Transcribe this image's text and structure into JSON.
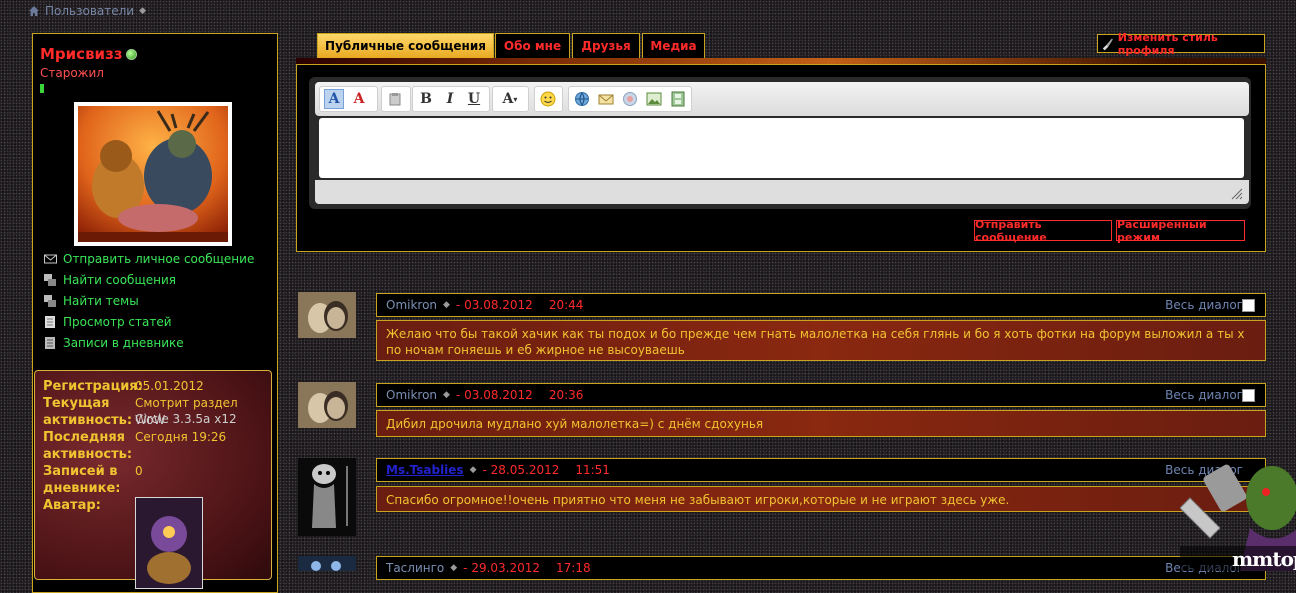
{
  "breadcrumb": {
    "item": "Пользователи"
  },
  "profile": {
    "username": "Мрисвизз",
    "title": "Старожил",
    "links": [
      {
        "label": "Отправить личное сообщение",
        "icon": "envelope-icon"
      },
      {
        "label": "Найти сообщения",
        "icon": "posts-icon"
      },
      {
        "label": "Найти темы",
        "icon": "threads-icon"
      },
      {
        "label": "Просмотр статей",
        "icon": "article-icon"
      },
      {
        "label": "Записи в дневнике",
        "icon": "diary-icon"
      }
    ],
    "info": {
      "reg_label": "Регистрация:",
      "reg_value": "05.01.2012",
      "act_label1": "Текущая",
      "act_label2": "активность:",
      "act_value": "Смотрит раздел",
      "act_link": "WoW",
      "act_value2": "Circle 3.3.5a x12",
      "last_label1": "Последняя",
      "last_label2": "активность:",
      "last_value": "Сегодня 19:26",
      "diary_label1": "Записей в",
      "diary_label2": "дневнике:",
      "diary_value": "0",
      "avatar_label": "Аватар:"
    }
  },
  "tabs": [
    {
      "label": "Публичные сообщения",
      "active": true
    },
    {
      "label": "Обо мне",
      "active": false
    },
    {
      "label": "Друзья",
      "active": false
    },
    {
      "label": "Медиа",
      "active": false
    }
  ],
  "style_button": "Изменить стиль профиля",
  "editor": {
    "send": "Отправить сообщение",
    "advanced": "Расширенный режим"
  },
  "messages": [
    {
      "author": "Omikron",
      "date": "- 03.08.2012",
      "time": "20:44",
      "dialog": "Весь диалог",
      "text": "Желаю что бы такой хачик как ты подох и бо прежде чем гнать малолетка на себя глянь и бо я хоть фотки на форум выложил а ты х по ночам гоняешь и еб жирное не высоуваешь"
    },
    {
      "author": "Omikron",
      "date": "- 03.08.2012",
      "time": "20:36",
      "dialog": "Весь диалог",
      "text": "Дибил дрочила мудлано хуй малолетка=) с днём сдохунья"
    },
    {
      "author": "Ms.Tsablies",
      "date": "- 28.05.2012",
      "time": "11:51",
      "dialog": "Весь диалог",
      "text": "Спасибо огромное!!очень приятно что меня не забывают игроки,которые и не играют здесь уже."
    },
    {
      "author": "Таслинго",
      "date": "- 29.03.2012",
      "time": "17:18",
      "dialog": "Весь диалог",
      "text": ""
    }
  ],
  "watermark": "mmtop"
}
